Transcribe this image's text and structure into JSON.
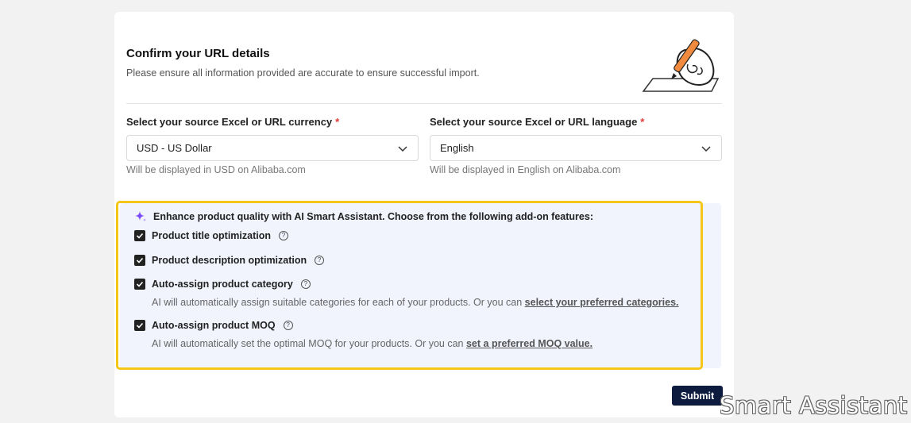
{
  "header": {
    "title": "Confirm your URL details",
    "subtitle": "Please ensure all information provided are accurate to ensure successful import."
  },
  "currency": {
    "label": "Select your source Excel or URL currency",
    "required_mark": "*",
    "value": "USD - US Dollar",
    "hint": "Will be displayed in USD on Alibaba.com"
  },
  "language": {
    "label": "Select your source Excel or URL language",
    "required_mark": "*",
    "value": "English",
    "hint": "Will be displayed in English on Alibaba.com"
  },
  "ai_assistant": {
    "title": "Enhance product quality with AI Smart Assistant. Choose from the following add-on features:",
    "icon": "sparkle-icon",
    "accent_color": "#7b4dff",
    "options": [
      {
        "label": "Product title optimization",
        "checked": true
      },
      {
        "label": "Product description optimization",
        "checked": true
      },
      {
        "label": "Auto-assign product category",
        "checked": true,
        "description": "AI will automatically assign suitable categories for each of your products. Or you can ",
        "link": "select your preferred categories."
      },
      {
        "label": "Auto-assign product MOQ",
        "checked": true,
        "description": "AI will automatically set the optimal MOQ for your products. Or you can ",
        "link": "set a preferred MOQ value."
      }
    ]
  },
  "help_glyph": "?",
  "submit_label": "Submit",
  "watermark": "Smart Assistant",
  "colors": {
    "highlight": "#f5c518",
    "panel_bg": "#f1f3fd",
    "submit_bg": "#0d1b3e"
  }
}
